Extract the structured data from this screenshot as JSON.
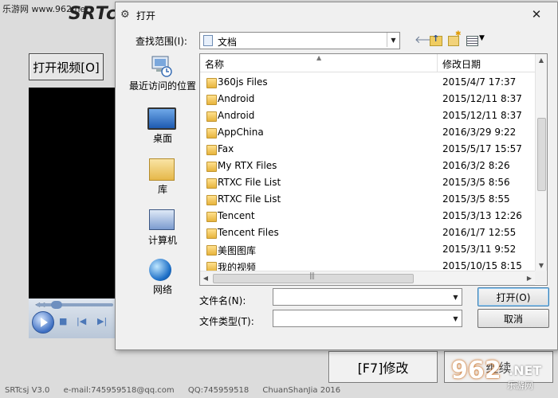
{
  "watermark": {
    "top_text": "乐游网 www.962.net",
    "logo_number": "962",
    "logo_net": ".NET",
    "logo_cn": "乐游网"
  },
  "app": {
    "title": "SRTc",
    "open_video_label": "打开视频[O]",
    "modify_label": "[F7]修改",
    "continue_label": "继续",
    "status": {
      "version": "SRTcsj V3.0",
      "email": "e-mail:745959518@qq.com",
      "qq": "QQ:745959518",
      "author": "ChuanShanJia 2016"
    }
  },
  "dialog": {
    "title": "打开",
    "lookin_label": "查找范围(I):",
    "lookin_value": "文档",
    "places": [
      {
        "label": "最近访问的位置",
        "icon": "recent-places-icon"
      },
      {
        "label": "桌面",
        "icon": "desktop-icon"
      },
      {
        "label": "库",
        "icon": "library-icon"
      },
      {
        "label": "计算机",
        "icon": "computer-icon"
      },
      {
        "label": "网络",
        "icon": "network-icon"
      }
    ],
    "columns": {
      "name": "名称",
      "date": "修改日期"
    },
    "files": [
      {
        "name": "360js Files",
        "date": "2015/4/7 17:37"
      },
      {
        "name": "Android",
        "date": "2015/12/11 8:37"
      },
      {
        "name": "Android",
        "date": "2015/12/11 8:37"
      },
      {
        "name": "AppChina",
        "date": "2016/3/29 9:22"
      },
      {
        "name": "Fax",
        "date": "2015/5/17 15:57"
      },
      {
        "name": "My RTX Files",
        "date": "2016/3/2 8:26"
      },
      {
        "name": "RTXC File List",
        "date": "2015/3/5 8:56"
      },
      {
        "name": "RTXC File List",
        "date": "2015/3/5 8:55"
      },
      {
        "name": "Tencent",
        "date": "2015/3/13 12:26"
      },
      {
        "name": "Tencent Files",
        "date": "2016/1/7 12:55"
      },
      {
        "name": "美图图库",
        "date": "2015/3/11 9:52"
      },
      {
        "name": "我的视频",
        "date": "2015/10/15 8:15"
      }
    ],
    "filename_label": "文件名(N):",
    "filename_value": "",
    "filetype_label": "文件类型(T):",
    "filetype_value": "",
    "open_button": "打开(O)",
    "cancel_button": "取消"
  }
}
